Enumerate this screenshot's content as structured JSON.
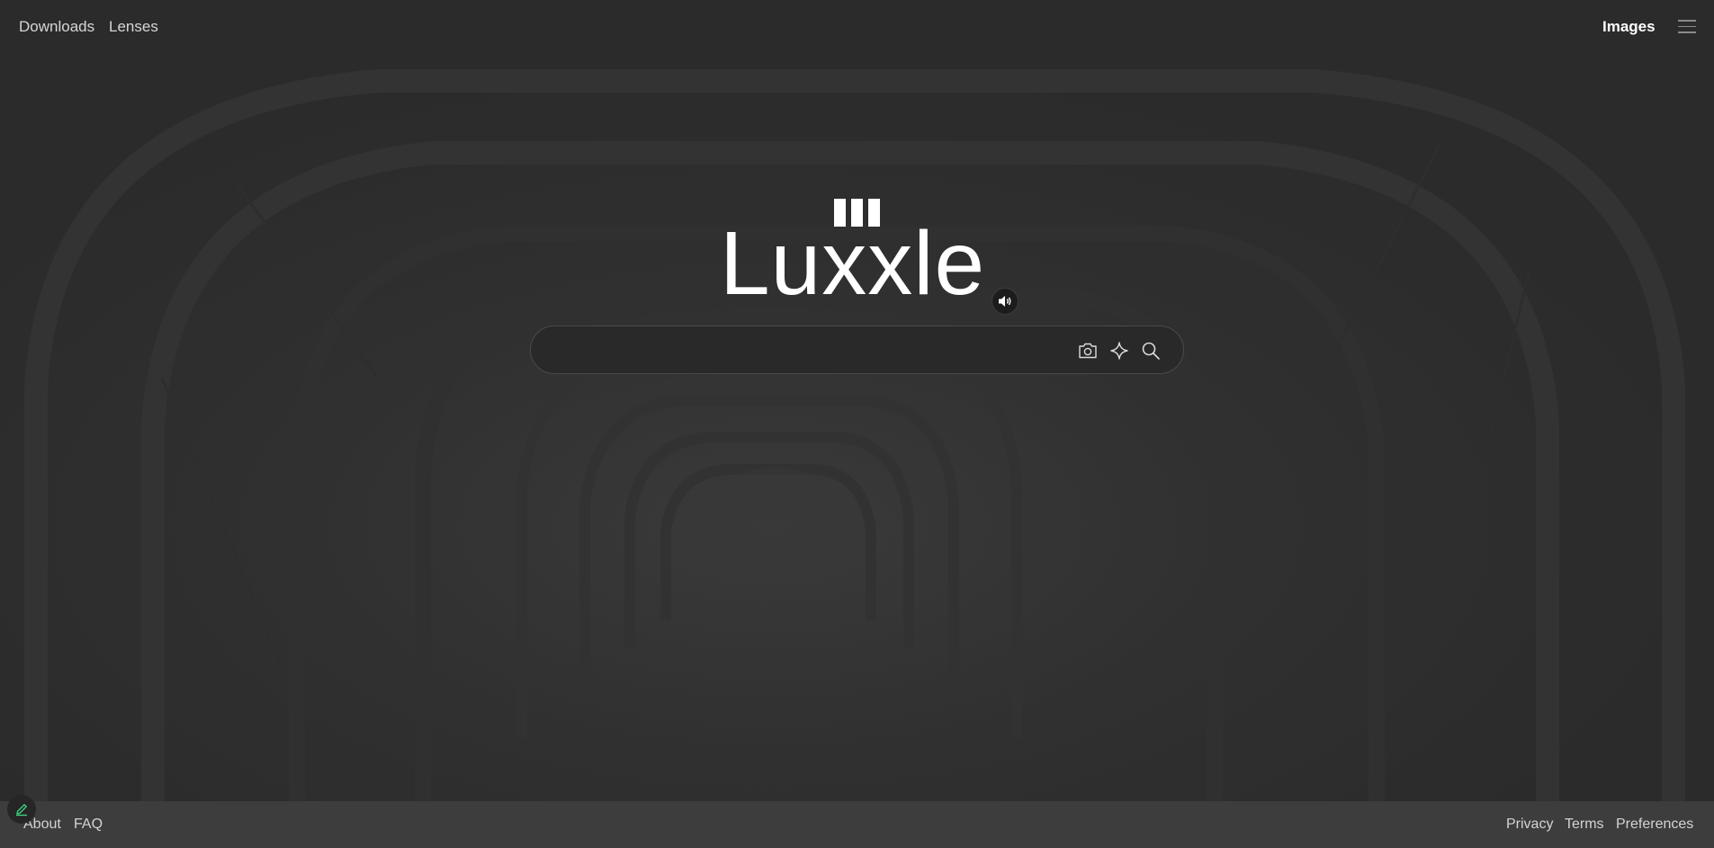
{
  "topnav": {
    "left_links": [
      "Downloads",
      "Lenses"
    ],
    "right_link": "Images",
    "menu_icon": "hamburger-menu-icon"
  },
  "logo": {
    "text": "Luxxle"
  },
  "search": {
    "value": "",
    "placeholder": "",
    "icons": [
      "camera-icon",
      "sparkle-icon",
      "search-icon"
    ]
  },
  "speaker_icon": "speaker-icon",
  "footer": {
    "left_links": [
      "About",
      "FAQ"
    ],
    "right_links": [
      "Privacy",
      "Terms",
      "Preferences"
    ],
    "edit_icon": "pencil-icon"
  },
  "colors": {
    "background": "#2d2d2d",
    "footer": "#3d3d3d",
    "text": "#d6d6d6",
    "logo": "#ffffff",
    "edit_accent": "#3ddc84"
  }
}
